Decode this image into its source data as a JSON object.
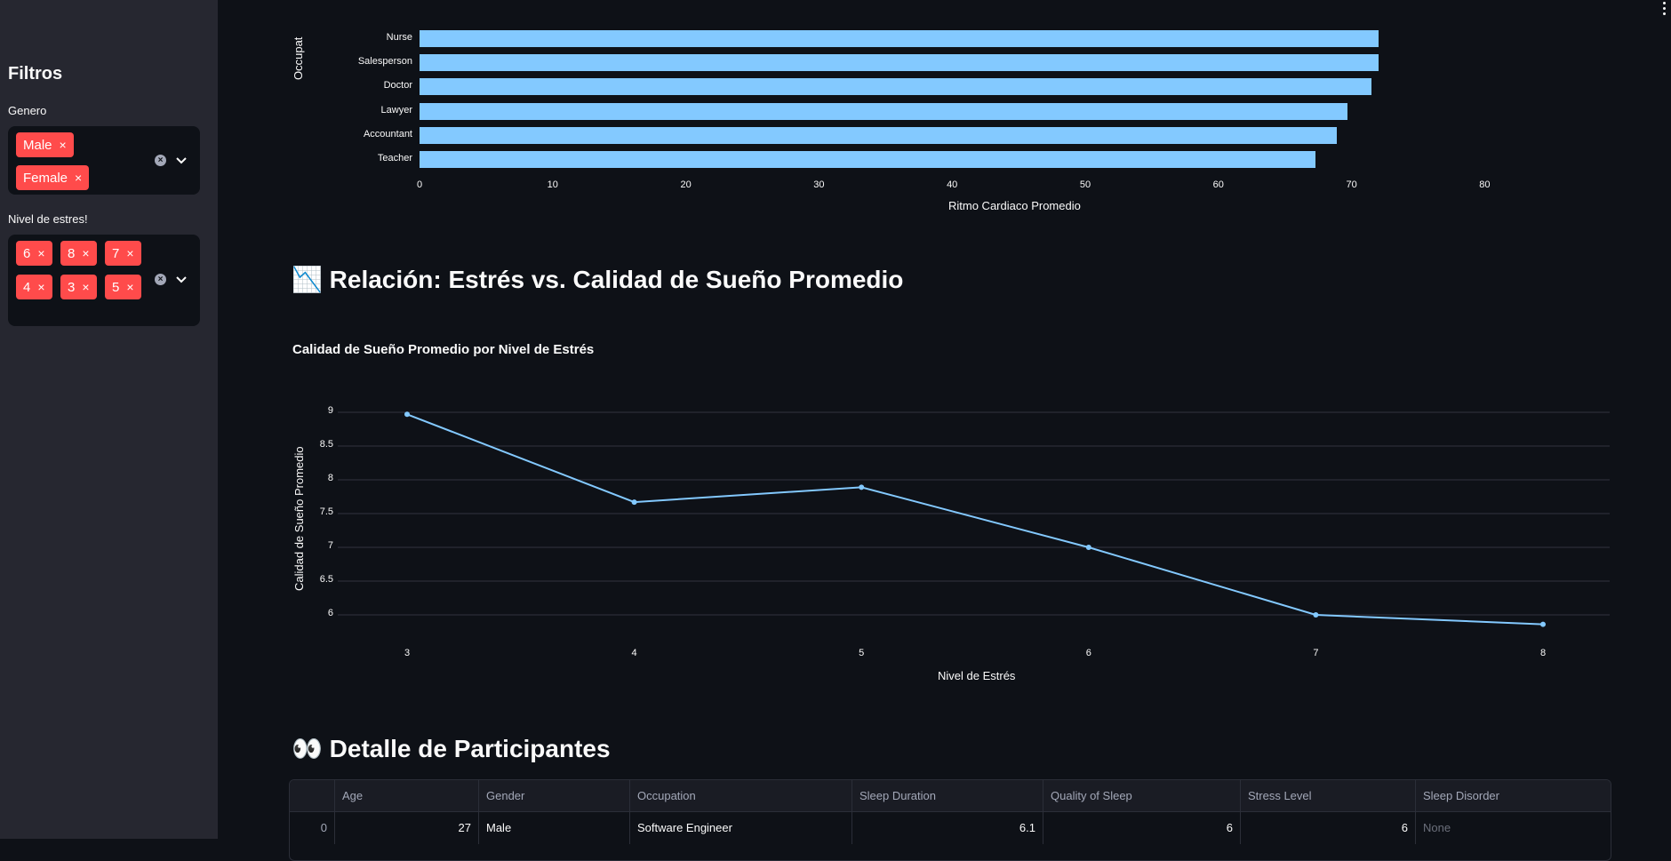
{
  "sidebar": {
    "title": "Filtros",
    "gender_label": "Genero",
    "gender_chips": [
      "Male",
      "Female"
    ],
    "stress_label": "Nivel de estres!",
    "stress_chips": [
      "6",
      "8",
      "7",
      "4",
      "3",
      "5"
    ],
    "chip_remove": "×"
  },
  "heart_chart": {
    "partial_ylabel": "Occupat",
    "xlabel": "Ritmo Cardiaco Promedio",
    "xticks": [
      "0",
      "10",
      "20",
      "30",
      "40",
      "50",
      "60",
      "70",
      "80"
    ]
  },
  "section2": {
    "icon": "📉",
    "title": "Relación: Estrés vs. Calidad de Sueño Promedio"
  },
  "line_chart": {
    "title": "Calidad de Sueño Promedio por Nivel de Estrés",
    "ylabel": "Calidad de Sueño Promedio",
    "xlabel": "Nivel de Estrés",
    "yticks": [
      "9",
      "8.5",
      "8",
      "7.5",
      "7",
      "6.5",
      "6"
    ],
    "xticks": [
      "3",
      "4",
      "5",
      "6",
      "7",
      "8"
    ]
  },
  "section3": {
    "icon": "👀",
    "title": "Detalle de Participantes"
  },
  "table": {
    "columns": [
      "",
      "Age",
      "Gender",
      "Occupation",
      "Sleep Duration",
      "Quality of Sleep",
      "Stress Level",
      "Sleep Disorder"
    ],
    "rows": [
      [
        "0",
        "27",
        "Male",
        "Software Engineer",
        "6.1",
        "6",
        "6",
        "None"
      ]
    ]
  },
  "chart_data": [
    {
      "type": "bar",
      "orientation": "horizontal",
      "categories": [
        "Nurse",
        "Salesperson",
        "Doctor",
        "Lawyer",
        "Accountant",
        "Teacher"
      ],
      "values": [
        72.0,
        72.0,
        71.5,
        69.7,
        68.9,
        67.3
      ],
      "title": "",
      "xlabel": "Ritmo Cardiaco Promedio",
      "ylabel": "Occupat",
      "xlim": [
        0,
        85
      ],
      "color": "#83c9ff",
      "grid": false
    },
    {
      "type": "line",
      "title": "Calidad de Sueño Promedio por Nivel de Estrés",
      "x": [
        3,
        4,
        5,
        6,
        7,
        8
      ],
      "y": [
        8.97,
        7.67,
        7.89,
        7.0,
        6.0,
        5.86
      ],
      "xlabel": "Nivel de Estrés",
      "ylabel": "Calidad de Sueño Promedio",
      "ylim": [
        5.6,
        9.05
      ],
      "color": "#83c9ff",
      "grid": true
    }
  ]
}
